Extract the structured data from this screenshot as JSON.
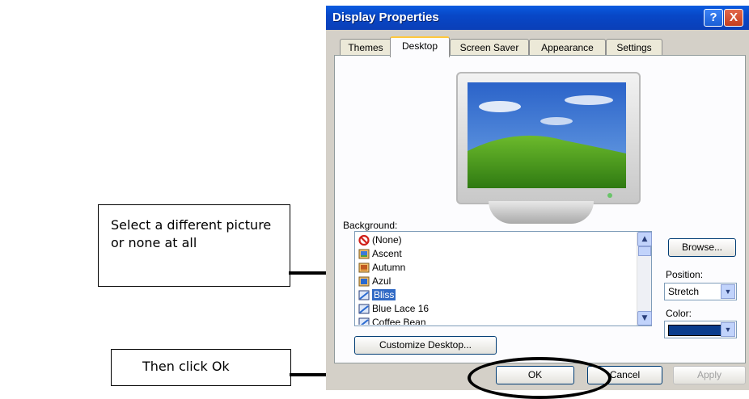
{
  "window": {
    "title": "Display Properties",
    "help_label": "?",
    "close_label": "X"
  },
  "tabs": [
    {
      "label": "Themes"
    },
    {
      "label": "Desktop"
    },
    {
      "label": "Screen Saver"
    },
    {
      "label": "Appearance"
    },
    {
      "label": "Settings"
    }
  ],
  "background": {
    "label": "Background:",
    "items": [
      {
        "label": "(None)"
      },
      {
        "label": "Ascent"
      },
      {
        "label": "Autumn"
      },
      {
        "label": "Azul"
      },
      {
        "label": "Bliss"
      },
      {
        "label": "Blue Lace 16"
      },
      {
        "label": "Coffee Bean"
      }
    ],
    "selected": "Bliss"
  },
  "buttons": {
    "browse": "Browse...",
    "customize": "Customize Desktop...",
    "ok": "OK",
    "cancel": "Cancel",
    "apply": "Apply"
  },
  "position": {
    "label": "Position:",
    "value": "Stretch"
  },
  "color": {
    "label": "Color:",
    "value": "#0a3c8c"
  },
  "callouts": {
    "select_picture": "Select a different picture or none at all",
    "click_ok": "Then click Ok"
  },
  "icons": [
    "help-icon",
    "close-icon",
    "none-icon",
    "image-file-icon",
    "scroll-up-icon",
    "scroll-down-icon",
    "dropdown-arrow-icon"
  ]
}
